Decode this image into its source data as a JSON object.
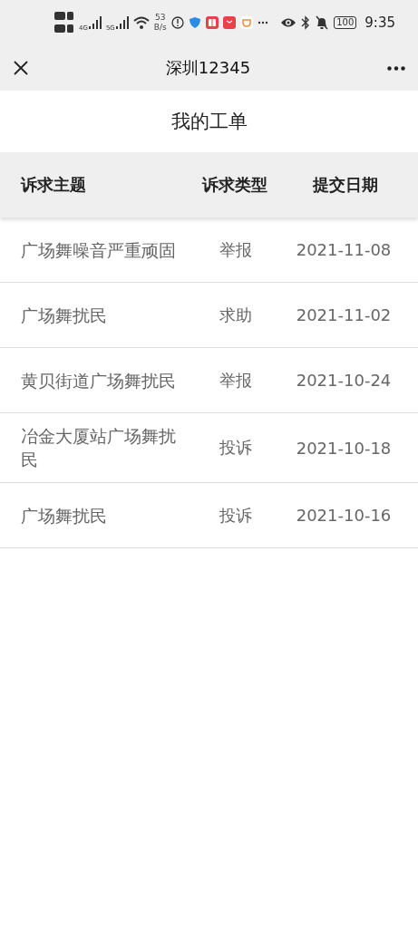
{
  "status_bar": {
    "network_speed": "53",
    "network_unit": "B/s",
    "battery": "100",
    "time": "9:35",
    "signal_labels": [
      "4G",
      "5G"
    ]
  },
  "nav_bar": {
    "title": "深圳12345"
  },
  "page_title": "我的工单",
  "table": {
    "columns": [
      "诉求主题",
      "诉求类型",
      "提交日期"
    ],
    "rows": [
      {
        "subject": "广场舞噪音严重顽固",
        "type": "举报",
        "date": "2021-11-08"
      },
      {
        "subject": "广场舞扰民",
        "type": "求助",
        "date": "2021-11-02"
      },
      {
        "subject": "黄贝街道广场舞扰民",
        "type": "举报",
        "date": "2021-10-24"
      },
      {
        "subject": "冶金大厦站广场舞扰民",
        "type": "投诉",
        "date": "2021-10-18"
      },
      {
        "subject": "广场舞扰民",
        "type": "投诉",
        "date": "2021-10-16"
      }
    ]
  }
}
